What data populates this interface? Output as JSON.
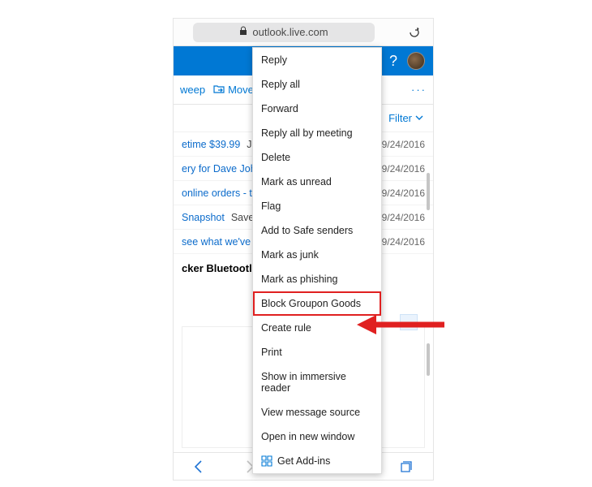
{
  "browser": {
    "url": "outlook.live.com"
  },
  "appbar": {
    "help_label": "?"
  },
  "toolbar": {
    "sweep_label": "weep",
    "move_label": "Move",
    "more_label": "···"
  },
  "filter": {
    "label": "Filter"
  },
  "messages": [
    {
      "subject": "etime $39.99",
      "preview": "Ju",
      "date": "9/24/2016"
    },
    {
      "subject": "ery for Dave Joh",
      "preview": "",
      "date": "9/24/2016"
    },
    {
      "subject": "online orders - t",
      "preview": "",
      "date": "9/24/2016"
    },
    {
      "subject": "Snapshot",
      "preview": "Save",
      "date": "9/24/2016"
    },
    {
      "subject": "see what we've",
      "preview": "",
      "date": "9/24/2016"
    }
  ],
  "selected": {
    "subject": "cker Bluetootl"
  },
  "pane": {
    "more_label": "···"
  },
  "ctxmenu": {
    "items": {
      "reply": "Reply",
      "reply_all": "Reply all",
      "forward": "Forward",
      "reply_all_meeting": "Reply all by meeting",
      "delete": "Delete",
      "mark_unread": "Mark as unread",
      "flag": "Flag",
      "add_safe": "Add to Safe senders",
      "mark_junk": "Mark as junk",
      "mark_phishing": "Mark as phishing",
      "block": "Block Groupon Goods",
      "create_rule": "Create rule",
      "print": "Print",
      "immersive": "Show in immersive reader",
      "view_source": "View message source",
      "open_window": "Open in new window",
      "addins": "Get Add-ins"
    }
  }
}
